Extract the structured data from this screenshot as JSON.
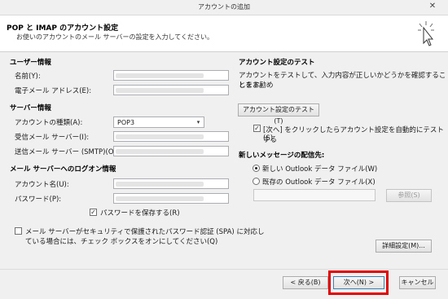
{
  "window": {
    "title": "アカウントの追加",
    "close": "✕"
  },
  "header": {
    "title": "POP と IMAP のアカウント設定",
    "subtitle": "お使いのアカウントのメール サーバーの設定を入力してください。"
  },
  "user_info": {
    "section": "ユーザー情報",
    "name_label": "名前(Y):",
    "email_label": "電子メール アドレス(E):"
  },
  "server_info": {
    "section": "サーバー情報",
    "account_type_label": "アカウントの種類(A):",
    "account_type_value": "POP3",
    "incoming_label": "受信メール サーバー(I):",
    "outgoing_label": "送信メール サーバー (SMTP)(O):"
  },
  "logon_info": {
    "section": "メール サーバーへのログオン情報",
    "account_name_label": "アカウント名(U):",
    "password_label": "パスワード(P):",
    "save_password_label": "パスワードを保存する(R)",
    "save_password_checked": true,
    "spa_label_line1": "メール サーバーがセキュリティで保護されたパスワード認証 (SPA) に対応し",
    "spa_label_line2": "ている場合には、チェック ボックスをオンにしてください(Q)",
    "spa_checked": false
  },
  "test": {
    "section": "アカウント設定のテスト",
    "desc_line1": "アカウントをテストして、入力内容が正しいかどうかを確認することをお勧め",
    "desc_line2": "します。",
    "test_button": "アカウント設定のテスト(T)",
    "auto_test_line1": "[次へ] をクリックしたらアカウント設定を自動的にテストする",
    "auto_test_line2": "(S)",
    "auto_test_checked": true
  },
  "delivery": {
    "section": "新しいメッセージの配信先:",
    "new_file_label": "新しい Outlook データ ファイル(W)",
    "existing_file_label": "既存の Outlook データ ファイル(X)",
    "browse_button": "参照(S)",
    "selected": "new"
  },
  "more_settings_button": "詳細設定(M)...",
  "footer": {
    "back": "< 戻る(B)",
    "next": "次へ(N) >",
    "cancel": "キャンセル"
  },
  "highlight_color": "#e00000"
}
